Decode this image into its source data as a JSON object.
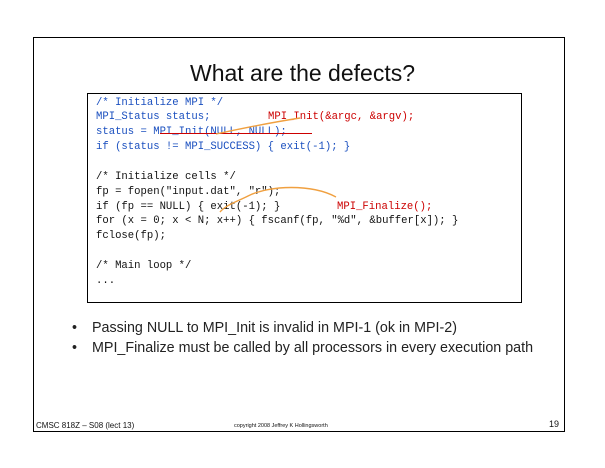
{
  "slide": {
    "title": "What are the defects?",
    "code": [
      "/* Initialize MPI */",
      "MPI_Status status;",
      "status = MPI_Init(NULL, NULL);",
      "if (status != MPI_SUCCESS) { exit(-1); }",
      "/* Initialize cells */",
      "fp = fopen(\"input.dat\", \"r\");",
      "if (fp == NULL) { exit(-1); }",
      "for (x = 0; x < N; x++) { fscanf(fp, \"%d\", &buffer[x]); }",
      "fclose(fp);",
      "/* Main loop */",
      "..."
    ],
    "annotations": {
      "mpi_init": "MPI_Init(&argc, &argv);",
      "mpi_finalize": "MPI_Finalize();"
    },
    "bullets": [
      "Passing NULL to MPI_Init is invalid in MPI-1 (ok in MPI-2)",
      "MPI_Finalize must be called by all processors in every execution path"
    ],
    "bullet_marker": "•",
    "footer": {
      "course": "CMSC 818Z – S08 (lect 13)",
      "copyright": "copyright 2008 Jeffrey K Hollingsworth",
      "page_number": "19"
    }
  },
  "colors": {
    "code_blue": "#1a4fbf",
    "annotation_red": "#cc0000",
    "arrow_orange": "#f0a040"
  }
}
